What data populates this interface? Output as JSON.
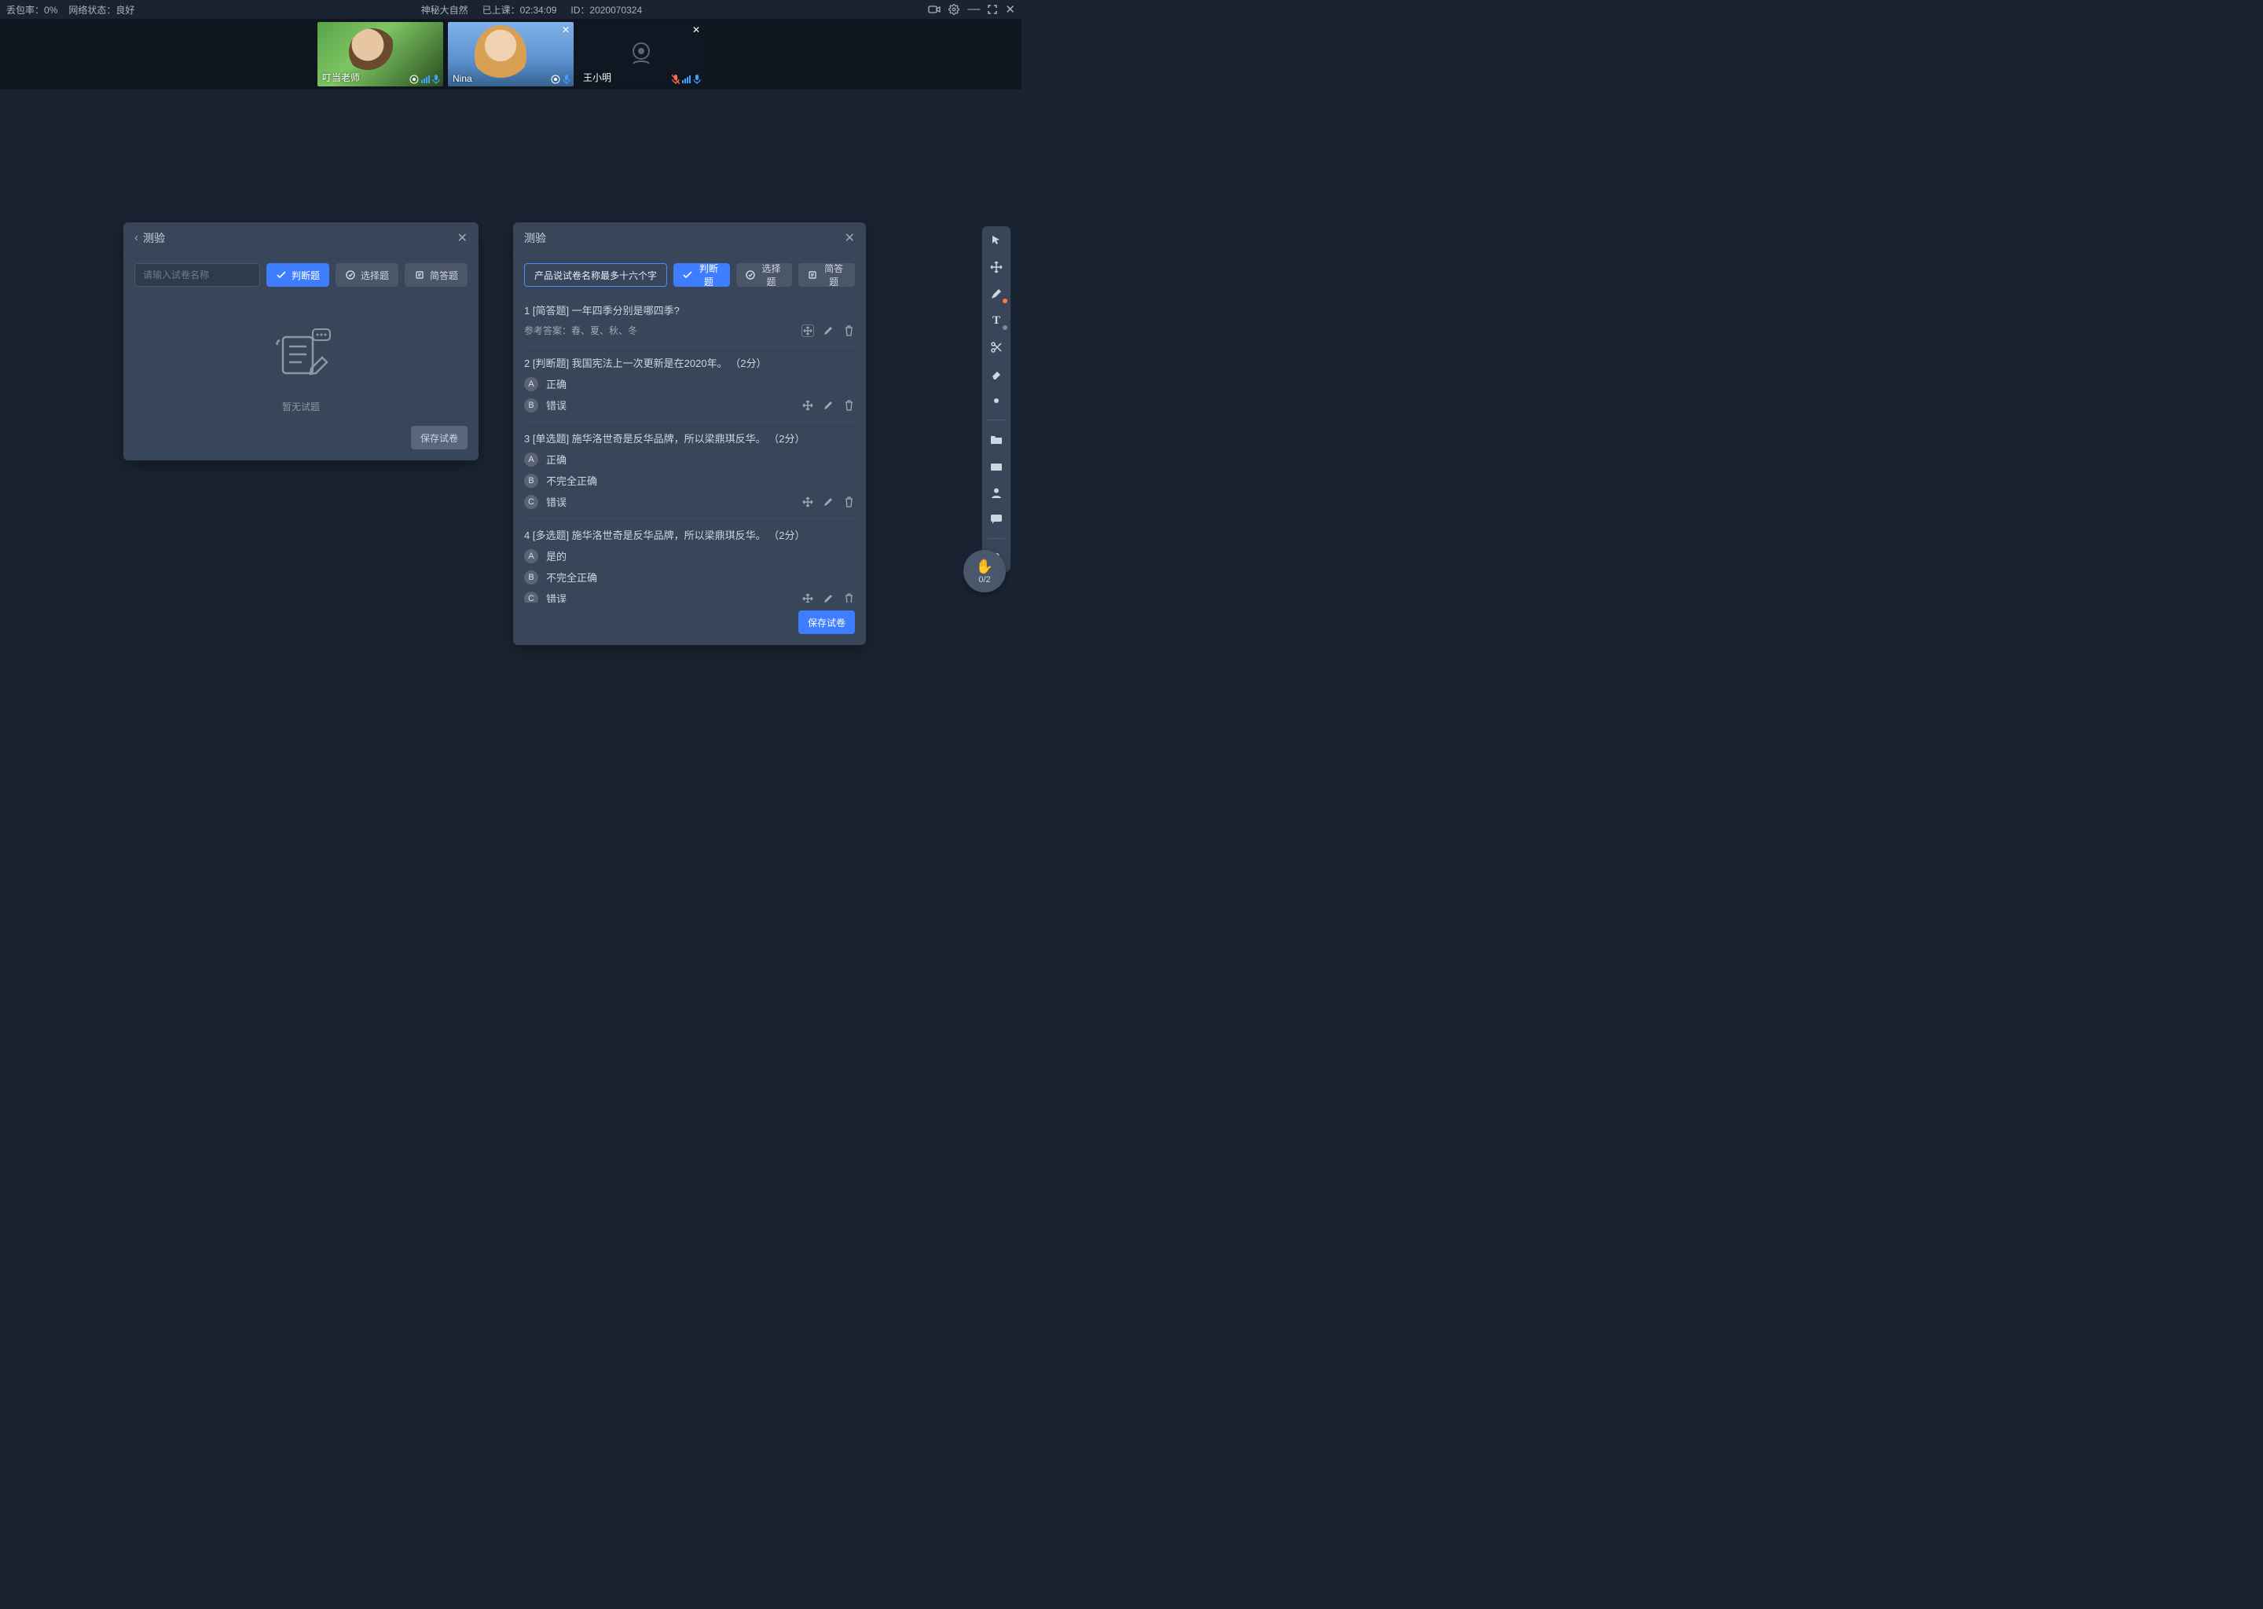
{
  "topbar": {
    "loss_label": "丢包率：",
    "loss_value": "0%",
    "net_label": "网络状态：",
    "net_value": "良好",
    "title": "神秘大自然",
    "elapsed_label": "已上课：",
    "elapsed_value": "02:34:09",
    "id_label": "ID：",
    "id_value": "2020070324"
  },
  "participants": [
    {
      "name": "叮当老师",
      "mic": "on",
      "signal": true,
      "camera": "on",
      "closable": false
    },
    {
      "name": "Nina",
      "mic": "on",
      "signal": false,
      "camera": "on",
      "closable": true
    },
    {
      "name": "王小明",
      "mic": "on",
      "signal": true,
      "camera": "off",
      "closable": true,
      "mic_muted": true
    }
  ],
  "left_panel": {
    "title": "测验",
    "search_placeholder": "请输入试卷名称",
    "tabs": {
      "judge": "判断题",
      "choice": "选择题",
      "short": "简答题"
    },
    "empty": "暂无试题",
    "save": "保存试卷"
  },
  "right_panel": {
    "title": "测验",
    "paper_name": "产品说试卷名称最多十六个字",
    "tabs": {
      "judge": "判断题",
      "choice": "选择题",
      "short": "简答题"
    },
    "save": "保存试卷",
    "scroll_hint": true,
    "questions": [
      {
        "num": "1",
        "type": "[简答题]",
        "text": "一年四季分别是哪四季?",
        "answer_label": "参考答案：",
        "answer": "春、夏、秋、冬",
        "options": []
      },
      {
        "num": "2",
        "type": "[判断题]",
        "text": "我国宪法上一次更新是在2020年。",
        "points": "（2分）",
        "options": [
          {
            "key": "A",
            "label": "正确"
          },
          {
            "key": "B",
            "label": "错误"
          }
        ]
      },
      {
        "num": "3",
        "type": "[单选题]",
        "text": "施华洛世奇是反华品牌，所以梁鼎琪反华。",
        "points": "（2分）",
        "options": [
          {
            "key": "A",
            "label": "正确"
          },
          {
            "key": "B",
            "label": "不完全正确"
          },
          {
            "key": "C",
            "label": "错误"
          }
        ]
      },
      {
        "num": "4",
        "type": "[多选题]",
        "text": "施华洛世奇是反华品牌，所以梁鼎琪反华。",
        "points": "（2分）",
        "options": [
          {
            "key": "A",
            "label": "是的"
          },
          {
            "key": "B",
            "label": "不完全正确"
          },
          {
            "key": "C",
            "label": "错误"
          }
        ]
      }
    ]
  },
  "hand": {
    "count": "0/2"
  },
  "colors": {
    "accent": "#3f7dff"
  }
}
